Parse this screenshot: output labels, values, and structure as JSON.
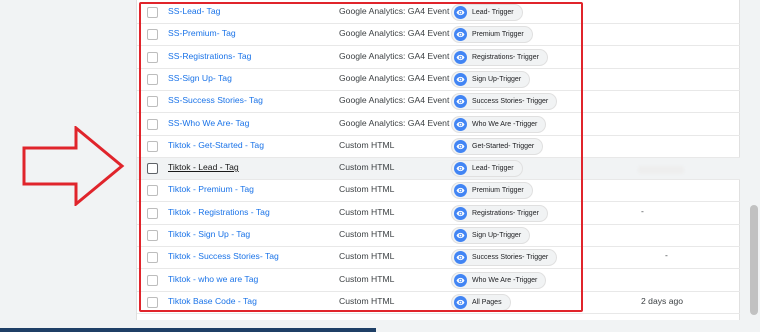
{
  "tags": [
    {
      "name": "SS-Lead- Tag",
      "type": "Google Analytics: GA4 Event",
      "trigger": "Lead- Trigger",
      "modified": ""
    },
    {
      "name": "SS-Premium- Tag",
      "type": "Google Analytics: GA4 Event",
      "trigger": "Premium Trigger",
      "modified": ""
    },
    {
      "name": "SS-Registrations- Tag",
      "type": "Google Analytics: GA4 Event",
      "trigger": "Registrations- Trigger",
      "modified": ""
    },
    {
      "name": "SS-Sign Up- Tag",
      "type": "Google Analytics: GA4 Event",
      "trigger": "Sign Up-Trigger",
      "modified": ""
    },
    {
      "name": "SS-Success Stories- Tag",
      "type": "Google Analytics: GA4 Event",
      "trigger": "Success Stories- Trigger",
      "modified": ""
    },
    {
      "name": "SS-Who We Are- Tag",
      "type": "Google Analytics: GA4 Event",
      "trigger": "Who We Are -Trigger",
      "modified": ""
    },
    {
      "name": "Tiktok - Get-Started - Tag",
      "type": "Custom HTML",
      "trigger": "Get-Started- Trigger",
      "modified": ""
    },
    {
      "name": "Tiktok - Lead - Tag",
      "type": "Custom HTML",
      "trigger": "Lead- Trigger",
      "modified": ""
    },
    {
      "name": "Tiktok - Premium - Tag",
      "type": "Custom HTML",
      "trigger": "Premium Trigger",
      "modified": ""
    },
    {
      "name": "Tiktok - Registrations - Tag",
      "type": "Custom HTML",
      "trigger": "Registrations- Trigger",
      "modified": "-"
    },
    {
      "name": "Tiktok - Sign Up - Tag",
      "type": "Custom HTML",
      "trigger": "Sign Up-Trigger",
      "modified": ""
    },
    {
      "name": "Tiktok - Success Stories- Tag",
      "type": "Custom HTML",
      "trigger": "Success Stories- Trigger",
      "modified": "-"
    },
    {
      "name": "Tiktok - who we are Tag",
      "type": "Custom HTML",
      "trigger": "Who We Are -Trigger",
      "modified": ""
    },
    {
      "name": "Tiktok Base Code - Tag",
      "type": "Custom HTML",
      "trigger": "All Pages",
      "modified": "2 days ago"
    }
  ],
  "hover_row_index": 7,
  "highlight_color": "#e0242b",
  "trigger_icon": "eye-icon"
}
